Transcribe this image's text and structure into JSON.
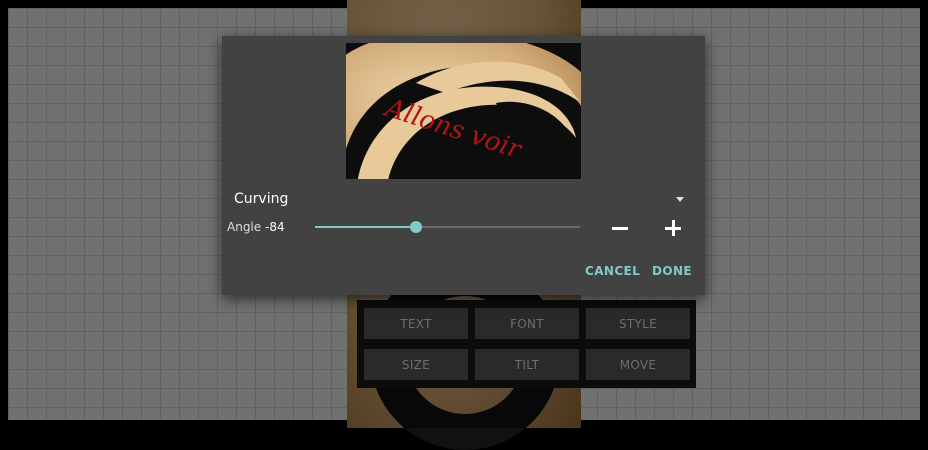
{
  "dialog": {
    "preview_text": "Allons voir",
    "curving_label": "Curving",
    "angle_label": "Angle",
    "angle_value": "-84",
    "angle_slider_fraction": 0.38,
    "cancel_label": "CANCEL",
    "done_label": "DONE"
  },
  "toolbar": {
    "items": [
      "TEXT",
      "FONT",
      "STYLE",
      "SIZE",
      "TILT",
      "MOVE"
    ]
  },
  "colors": {
    "accent": "#80cbc4",
    "dialog_bg": "#424242",
    "preview_text": "#b01414"
  },
  "icons": {
    "dropdown": "chevron-down-icon",
    "minus": "minus-icon",
    "plus": "plus-icon"
  }
}
